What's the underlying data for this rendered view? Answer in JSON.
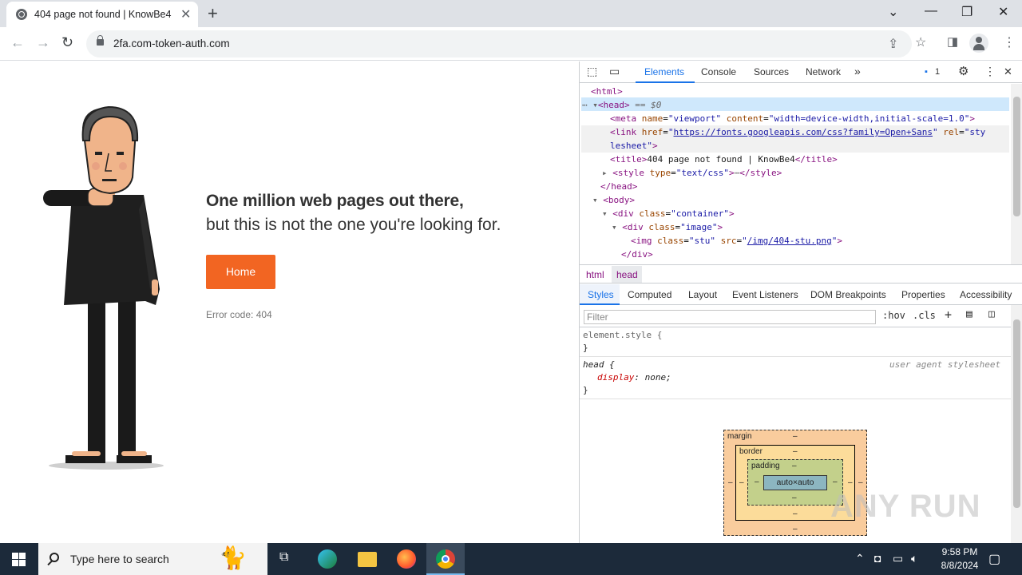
{
  "browser": {
    "tab_title": "404 page not found | KnowBe4",
    "url": "2fa.com-token-auth.com"
  },
  "page": {
    "heading_line1": "One million web pages out there,",
    "heading_line2": "but this is not the one you're looking for.",
    "home_button": "Home",
    "error_code": "Error code: 404"
  },
  "devtools": {
    "tabs": [
      "Elements",
      "Console",
      "Sources",
      "Network"
    ],
    "issues_count": "1",
    "dom": {
      "html_open": "<html>",
      "head_open": "<head>",
      "selected_marker": " == $0",
      "meta_tag": "meta",
      "meta_name_attr": "name",
      "meta_name_val": "\"viewport\"",
      "meta_content_attr": "content",
      "meta_content_val": "\"width=device-width,initial-scale=1.0\"",
      "link_tag": "link",
      "link_href_attr": "href",
      "link_href_val": "https://fonts.googleapis.com/css?family=Open+Sans",
      "link_rel_attr": "rel",
      "link_rel_val_a": "\"sty",
      "link_rel_val_b": "lesheet\"",
      "title_text": "404 page not found | KnowBe4",
      "style_type_val": "\"text/css\"",
      "ellipsis": "⋯",
      "head_close": "</head>",
      "body_open": "<body>",
      "div_container_val": "\"container\"",
      "div_image_val": "\"image\"",
      "img_class_val": "\"stu\"",
      "img_src_val": "/img/404-stu.png",
      "div_close": "</div>"
    },
    "breadcrumb": [
      "html",
      "head"
    ],
    "style_tabs": [
      "Styles",
      "Computed",
      "Layout",
      "Event Listeners",
      "DOM Breakpoints",
      "Properties",
      "Accessibility"
    ],
    "filter_placeholder": "Filter",
    "hov_label": ":hov",
    "cls_label": ".cls",
    "element_style": "element.style {",
    "close_brace": "}",
    "head_rule_selector": "head {",
    "head_rule_prop": "display",
    "head_rule_value": "none;",
    "user_agent_label": "user agent stylesheet",
    "box_model": {
      "margin_label": "margin",
      "border_label": "border",
      "padding_label": "padding",
      "content": "auto×auto",
      "dash": "–"
    }
  },
  "watermark": "ANY RUN",
  "taskbar": {
    "search_placeholder": "Type here to search",
    "time": "9:58 PM",
    "date": "8/8/2024"
  }
}
